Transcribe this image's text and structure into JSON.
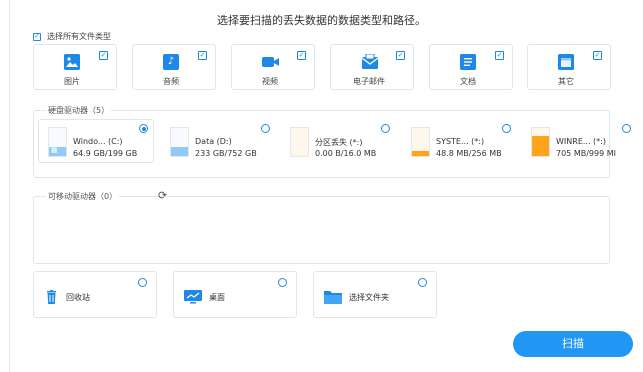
{
  "title": "选择要扫描的丢失数据的数据类型和路径。",
  "select_all": {
    "label": "选择所有文件类型",
    "checked": true
  },
  "file_types": [
    {
      "label": "图片",
      "icon": "image-icon",
      "checked": true
    },
    {
      "label": "音频",
      "icon": "music-icon",
      "checked": true
    },
    {
      "label": "视频",
      "icon": "video-icon",
      "checked": true
    },
    {
      "label": "电子邮件",
      "icon": "email-icon",
      "checked": true
    },
    {
      "label": "文档",
      "icon": "document-icon",
      "checked": true
    },
    {
      "label": "其它",
      "icon": "other-icon",
      "checked": true
    }
  ],
  "hard_drives": {
    "title": "硬盘驱动器（5）",
    "items": [
      {
        "name": "Windo... (C:)",
        "size": "64.9 GB/199 GB",
        "used_fraction": 0.33,
        "color": "#90caf9",
        "selected": true
      },
      {
        "name": "Data (D:)",
        "size": "233 GB/752 GB",
        "used_fraction": 0.31,
        "color": "#90caf9",
        "selected": false
      },
      {
        "name": "分区丢失 (*:)",
        "size": "0.00  B/16.0 MB",
        "used_fraction": 0.0,
        "color": "#ffa31a",
        "selected": false
      },
      {
        "name": "SYSTE... (*:)",
        "size": "48.8 MB/256 MB",
        "used_fraction": 0.19,
        "color": "#ffa31a",
        "selected": false
      },
      {
        "name": "WINRE... (*:)",
        "size": "705 MB/999 MI",
        "used_fraction": 0.71,
        "color": "#ffa31a",
        "selected": false
      }
    ]
  },
  "removable": {
    "title": "可移动驱动器（0）",
    "refresh_icon": "refresh-icon"
  },
  "locations": [
    {
      "label": "回收站",
      "icon": "recycle-bin-icon"
    },
    {
      "label": "桌面",
      "icon": "desktop-icon"
    },
    {
      "label": "选择文件夹",
      "icon": "folder-icon"
    }
  ],
  "scan_button": "扫描",
  "colors": {
    "accent": "#2196f3",
    "border": "#dfe6ee",
    "orange": "#ffa31a"
  }
}
